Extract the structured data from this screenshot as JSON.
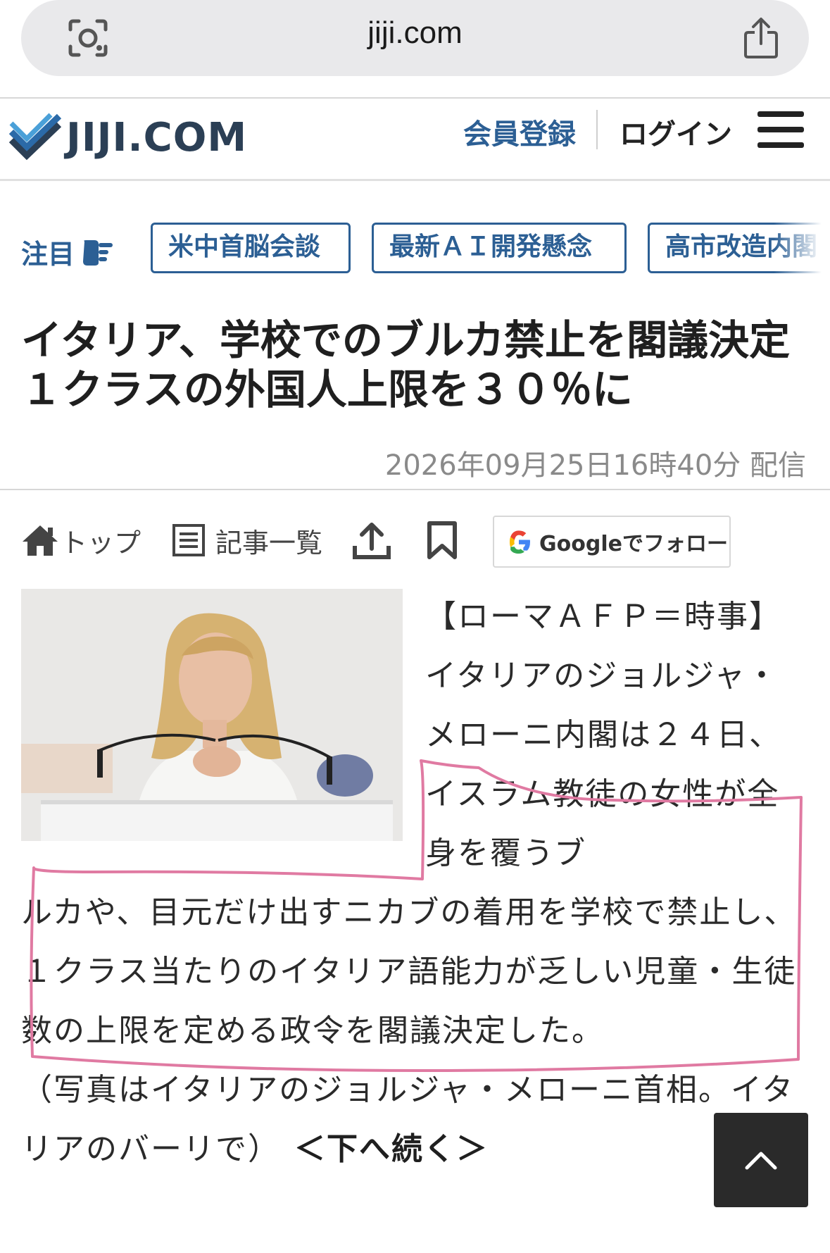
{
  "browser": {
    "url": "jiji.com",
    "lens_icon": "camera-lens-icon",
    "share_icon": "share-icon"
  },
  "header": {
    "logo_text": "JIJI.COM",
    "register_label": "会員登録",
    "login_label": "ログイン",
    "menu_icon": "hamburger-menu-icon"
  },
  "attention": {
    "label": "注目",
    "tags": [
      "米中首脳会談",
      "最新ＡＩ開発懸念",
      "高市改造内閣"
    ]
  },
  "article": {
    "headline": "イタリア、学校でのブルカ禁止を閣議決定 １クラスの外国人上限を３０％に",
    "published": "2026年09月25日16時40分 配信",
    "body_right": "【ローマＡＦＰ＝時事】イタリアのジョルジャ・メローニ内閣は２４日、イスラム教徒の女性が全身を覆うブ",
    "body_full": "ルカや、目元だけ出すニカブの着用を学校で禁止し、１クラス当たりのイタリア語能力が乏しい児童・生徒数の上限を定める政令を閣議決定した。",
    "caption": "（写真はイタリアのジョルジャ・メローニ首相。イタリアのバーリで）",
    "more_label": "＜下へ続く＞"
  },
  "toolbar": {
    "top_label": "トップ",
    "list_label": "記事一覧",
    "google_follow_label": "Googleでフォロー"
  },
  "colors": {
    "brand_blue": "#2c5f94",
    "highlight_pink": "#e07aa2",
    "back_to_top_bg": "#2a2a2a"
  }
}
